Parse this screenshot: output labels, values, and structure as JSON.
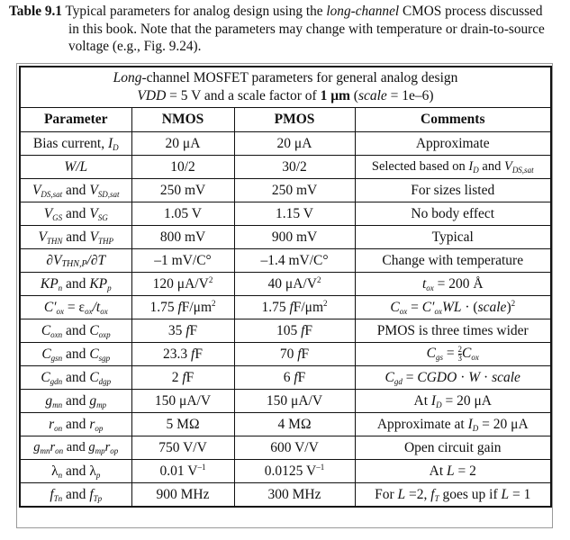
{
  "caption": {
    "label": "Table 9.1",
    "text_part1": " Typical parameters for analog design using the ",
    "text_italic": "long-channel",
    "text_part2": " CMOS process discussed",
    "text_line2": "in this book. Note that the parameters may change with temperature or drain-to-source",
    "text_line3": "voltage (e.g., Fig. 9.24)."
  },
  "table": {
    "title_line1_italic": "Long",
    "title_line1_rest": "-channel MOSFET parameters for general analog design",
    "title_line2_vdd": "VDD",
    "title_line2_a": " = 5 V and a scale factor of ",
    "title_line2_bold": "1 μm",
    "title_line2_b": " (",
    "title_line2_scale": "scale",
    "title_line2_c": " = 1e–6)",
    "headers": [
      "Parameter",
      "NMOS",
      "PMOS",
      "Comments"
    ],
    "rows": [
      {
        "param": "Bias current, I_D",
        "nmos": "20 μA",
        "pmos": "20 μA",
        "comment": "Approximate"
      },
      {
        "param": "W/L",
        "nmos": "10/2",
        "pmos": "30/2",
        "comment": "Selected based on I_D and V_DS,sat"
      },
      {
        "param": "V_DS,sat and V_SD,sat",
        "nmos": "250 mV",
        "pmos": "250 mV",
        "comment": "For sizes listed"
      },
      {
        "param": "V_GS and V_SG",
        "nmos": "1.05 V",
        "pmos": "1.15 V",
        "comment": "No body effect"
      },
      {
        "param": "V_THN and V_THP",
        "nmos": "800 mV",
        "pmos": "900 mV",
        "comment": "Typical"
      },
      {
        "param": "∂V_THN,P/∂T",
        "nmos": "–1 mV/C°",
        "pmos": "–1.4 mV/C°",
        "comment": "Change with temperature"
      },
      {
        "param": "KP_n and KP_p",
        "nmos": "120 μA/V²",
        "pmos": "40 μA/V²",
        "comment": "t_ox = 200 Å"
      },
      {
        "param": "C'_ox = ε_ox/t_ox",
        "nmos": "1.75 fF/μm²",
        "pmos": "1.75 fF/μm²",
        "comment": "C_ox = C'_ox WL · (scale)²"
      },
      {
        "param": "C_oxn and C_oxp",
        "nmos": "35 fF",
        "pmos": "105 fF",
        "comment": "PMOS is three times wider"
      },
      {
        "param": "C_gsn and C_sgp",
        "nmos": "23.3 fF",
        "pmos": "70 fF",
        "comment": "C_gs = 2/3 C_ox"
      },
      {
        "param": "C_gdn and C_dgp",
        "nmos": "2 fF",
        "pmos": "6 fF",
        "comment": "C_gd = CGDO · W · scale"
      },
      {
        "param": "g_mn and g_mp",
        "nmos": "150 μA/V",
        "pmos": "150 μA/V",
        "comment": "At I_D = 20 μA"
      },
      {
        "param": "r_on and r_op",
        "nmos": "5 MΩ",
        "pmos": "4 MΩ",
        "comment": "Approximate at I_D = 20 μA"
      },
      {
        "param": "g_mn r_on and g_mp r_op",
        "nmos": "750 V/V",
        "pmos": "600 V/V",
        "comment": "Open circuit gain"
      },
      {
        "param": "λ_n and λ_p",
        "nmos": "0.01 V⁻¹",
        "pmos": "0.0125 V⁻¹",
        "comment": "At L = 2"
      },
      {
        "param": "f_Tn and f_Tp",
        "nmos": "900 MHz",
        "pmos": "300 MHz",
        "comment": "For L =2, f_T goes up if L = 1"
      }
    ]
  },
  "glyphs": {
    "and": " and ",
    "I": "I",
    "D": "D",
    "V": "V",
    "W_L": "W/L",
    "DSsat": "DS,sat",
    "SDsat": "SD,sat",
    "GS": "GS",
    "SG": "SG",
    "THN": "THN",
    "THP": "THP",
    "THNP": "THN,P",
    "partial": "∂",
    "slashT": "/∂T",
    "KP": "KP",
    "n": "n",
    "p": "p",
    "C": "C",
    "Cprime": "C′",
    "ox": "ox",
    "eq": " = ",
    "eps": "ε",
    "slash_t": "/t",
    "oxn": "oxn",
    "oxp": "oxp",
    "gsn": "gsn",
    "sgp": "sgp",
    "gdn": "gdn",
    "dgp": "dgp",
    "g": "g",
    "mn": "mn",
    "mp": "mp",
    "r": "r",
    "on": "on",
    "op": "op",
    "lambda": "λ",
    "f": "f",
    "Tn": "Tn",
    "Tp": "Tp",
    "T": "T",
    "bias_current": "Bias current, ",
    "t": "t",
    "tox_rest": " = 200 Å",
    "WL": "WL",
    "dot": " · ",
    "scale_paren_open": "(",
    "scale": "scale",
    "scale_paren_close": ")",
    "sq": "2",
    "gs": "gs",
    "gd": "gd",
    "CGDO": "CGDO",
    "W": "W",
    "two": "2",
    "three": "3",
    "at": "At ",
    "eq20": " = 20 μA",
    "approx_at": "Approximate at ",
    "L": "L",
    "eq2": " = 2",
    "for": "For ",
    "eq2comma": " =2, ",
    "goes_up": " goes up if ",
    "eq1": " = 1",
    "selected": "Selected based on ",
    "fF_suffix": "F",
    "fF_unit_m2": "F/μm",
    "sup2": "2",
    "neg1": "–1"
  }
}
